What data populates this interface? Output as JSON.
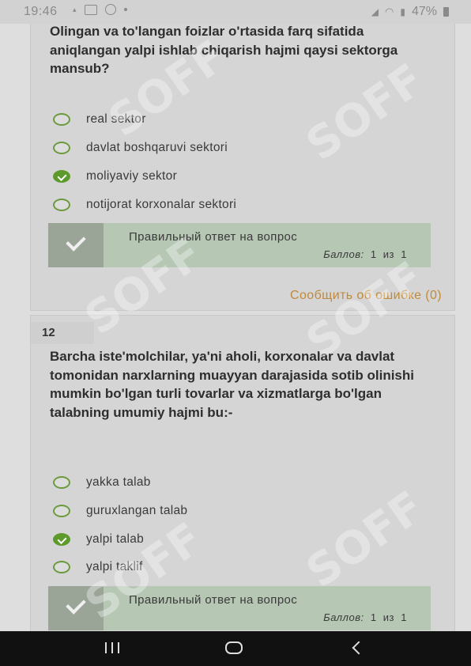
{
  "status_bar": {
    "time": "19:46",
    "battery": "47%"
  },
  "q11": {
    "text": "Olingan va to'langan foizlar o'rtasida farq sifatida aniqlangan yalpi ishlab chiqarish hajmi qaysi sektorga mansub?",
    "options": [
      {
        "label": "real sektor",
        "checked": false
      },
      {
        "label": "davlat boshqaruvi sektori",
        "checked": false
      },
      {
        "label": "moliyaviy sektor",
        "checked": true
      },
      {
        "label": "notijorat korxonalar sektori",
        "checked": false
      }
    ],
    "feedback": "Правильный ответ на вопрос",
    "score_label": "Баллов:",
    "score": "1",
    "score_of": "из",
    "score_max": "1",
    "report": "Сообщить об ошибке (0)"
  },
  "q12": {
    "number": "12",
    "text": "Barcha iste'molchilar, ya'ni aholi, korxonalar va davlat tomonidan narxlarning muayyan darajasida sotib olinishi mumkin bo'lgan turli tovarlar va xizmatlarga bo'lgan talabning umumiy hajmi bu:-",
    "options": [
      {
        "label": "yakka talab",
        "checked": false
      },
      {
        "label": "guruxlangan talab",
        "checked": false
      },
      {
        "label": "yalpi talab",
        "checked": true
      },
      {
        "label": "yalpi taklif",
        "checked": false
      }
    ],
    "feedback": "Правильный ответ на вопрос",
    "score_label": "Баллов:",
    "score": "1",
    "score_of": "из",
    "score_max": "1"
  },
  "watermark_text": "SOFF"
}
